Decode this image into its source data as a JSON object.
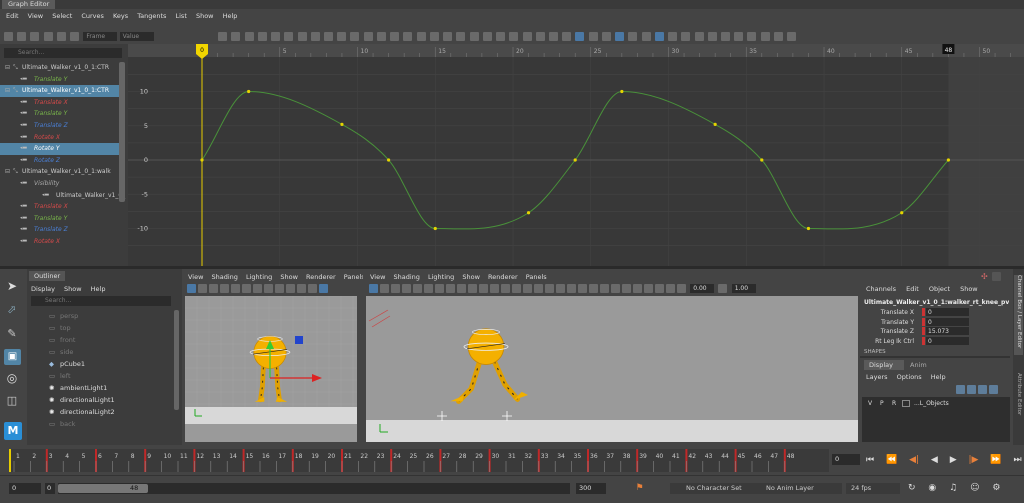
{
  "window": {
    "title": "Graph Editor"
  },
  "menus": [
    "Edit",
    "View",
    "Select",
    "Curves",
    "Keys",
    "Tangents",
    "List",
    "Show",
    "Help"
  ],
  "toolbar": {
    "frame_label": "Frame",
    "value_label": "Value"
  },
  "graph": {
    "search_placeholder": "Search...",
    "current_frame": "0",
    "end_frame": "48",
    "ruler_ticks": [
      "5",
      "10",
      "15",
      "20",
      "25",
      "30",
      "35",
      "40",
      "45",
      "50"
    ],
    "y_ticks": [
      "10",
      "5",
      "0",
      "-5",
      "-10"
    ],
    "curve_color": "#49913a",
    "keys": [
      [
        0,
        0
      ],
      [
        3,
        10
      ],
      [
        9,
        5.2
      ],
      [
        12,
        0
      ],
      [
        15,
        -10
      ],
      [
        21,
        -7.7
      ],
      [
        24,
        0
      ],
      [
        27,
        10
      ],
      [
        33,
        5.2
      ],
      [
        36,
        0
      ],
      [
        39,
        -10
      ],
      [
        45,
        -7.7
      ],
      [
        48,
        0
      ]
    ],
    "outliner_items": [
      {
        "label": "Ultimate_Walker_v1_0_1:CTR",
        "color": "#ccc",
        "type": "node",
        "selected": false
      },
      {
        "label": "Translate Y",
        "color": "#7ab84a",
        "type": "attr",
        "selected": false
      },
      {
        "label": "Ultimate_Walker_v1_0_1:CTR",
        "color": "#ccc",
        "type": "node",
        "selected": true
      },
      {
        "label": "Translate X",
        "color": "#d84a4a",
        "type": "attr",
        "selected": false
      },
      {
        "label": "Translate Y",
        "color": "#7ab84a",
        "type": "attr",
        "selected": false
      },
      {
        "label": "Translate Z",
        "color": "#4a80d8",
        "type": "attr",
        "selected": false
      },
      {
        "label": "Rotate X",
        "color": "#d84a4a",
        "type": "attr",
        "selected": false
      },
      {
        "label": "Rotate Y",
        "color": "#7ab84a",
        "type": "attr",
        "selected": true
      },
      {
        "label": "Rotate Z",
        "color": "#4a80d8",
        "type": "attr",
        "selected": false
      },
      {
        "label": "Ultimate_Walker_v1_0_1:walk",
        "color": "#ccc",
        "type": "node",
        "selected": false
      },
      {
        "label": "Visibility",
        "color": "#aaa",
        "type": "attr",
        "selected": false
      },
      {
        "label": "Ultimate_Walker_v1_0_",
        "color": "#ccc",
        "type": "sub",
        "selected": false
      },
      {
        "label": "Translate X",
        "color": "#d84a4a",
        "type": "attr",
        "selected": false
      },
      {
        "label": "Translate Y",
        "color": "#7ab84a",
        "type": "attr",
        "selected": false
      },
      {
        "label": "Translate Z",
        "color": "#4a80d8",
        "type": "attr",
        "selected": false
      },
      {
        "label": "Rotate X",
        "color": "#d84a4a",
        "type": "attr",
        "selected": false
      }
    ]
  },
  "outliner": {
    "tab": "Outliner",
    "menu": [
      "Display",
      "Show",
      "Help"
    ],
    "search_placeholder": "Search...",
    "items": [
      {
        "label": "persp",
        "dim": true,
        "icon": "camera"
      },
      {
        "label": "top",
        "dim": true,
        "icon": "camera"
      },
      {
        "label": "front",
        "dim": true,
        "icon": "camera"
      },
      {
        "label": "side",
        "dim": true,
        "icon": "camera"
      },
      {
        "label": "pCube1",
        "dim": false,
        "icon": "mesh"
      },
      {
        "label": "left",
        "dim": true,
        "icon": "camera"
      },
      {
        "label": "ambientLight1",
        "dim": false,
        "icon": "light"
      },
      {
        "label": "directionalLight1",
        "dim": false,
        "icon": "light"
      },
      {
        "label": "directionalLight2",
        "dim": false,
        "icon": "light"
      },
      {
        "label": "back",
        "dim": true,
        "icon": "camera"
      }
    ]
  },
  "viewport_menu": [
    "View",
    "Shading",
    "Lighting",
    "Show",
    "Renderer",
    "Panels"
  ],
  "viewport2_menu": [
    "View",
    "Shading",
    "Lighting",
    "Show",
    "Renderer",
    "Panels"
  ],
  "viewport2_fields": {
    "a": "0.00",
    "b": "1.00"
  },
  "channels": {
    "menu": [
      "Channels",
      "Edit",
      "Object",
      "Show"
    ],
    "object_name": "Ultimate_Walker_v1_0_1:walker_rt_knee_pv_ctrl ...",
    "attrs": [
      {
        "label": "Translate X",
        "value": "0"
      },
      {
        "label": "Translate Y",
        "value": "0"
      },
      {
        "label": "Translate Z",
        "value": "15.073"
      },
      {
        "label": "Rt Leg Ik Ctrl",
        "value": "0"
      }
    ],
    "shapes_label": "SHAPES",
    "tabs": [
      "Display",
      "Anim"
    ],
    "layer_menu": [
      "Layers",
      "Options",
      "Help"
    ],
    "layer": {
      "v": "V",
      "p": "P",
      "r": "R",
      "name": "...L_Objects"
    },
    "side_tabs": [
      "Channel Box / Layer Editor",
      "Attribute Editor"
    ]
  },
  "timeline": {
    "ticks": [
      "1",
      "2",
      "3",
      "4",
      "5",
      "6",
      "7",
      "8",
      "9",
      "10",
      "11",
      "12",
      "13",
      "14",
      "15",
      "16",
      "17",
      "18",
      "19",
      "20",
      "21",
      "22",
      "23",
      "24",
      "25",
      "26",
      "27",
      "28",
      "29",
      "30",
      "31",
      "32",
      "33",
      "34",
      "35",
      "36",
      "37",
      "38",
      "39",
      "40",
      "41",
      "42",
      "43",
      "44",
      "45",
      "46",
      "47",
      "48"
    ],
    "keyed_frames": [
      3,
      6,
      9,
      12,
      15,
      18,
      21,
      24,
      27,
      30,
      33,
      36,
      39,
      42,
      45,
      48
    ],
    "current_frame_field": "0"
  },
  "range": {
    "start": "0",
    "inner_start": "0",
    "inner_end": "48",
    "end": "300",
    "character_set": "No Character Set",
    "anim_layer": "No Anim Layer",
    "fps": "24 fps"
  }
}
